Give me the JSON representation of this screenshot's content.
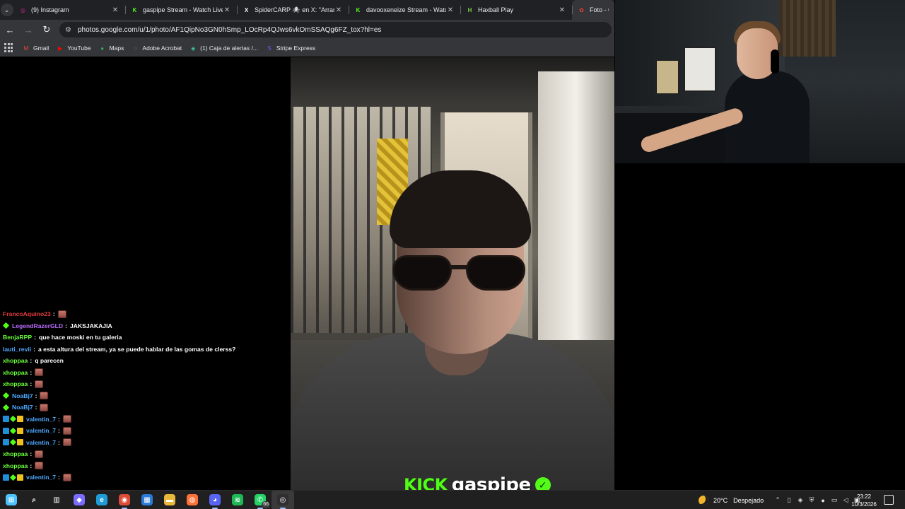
{
  "browser": {
    "tabs": [
      {
        "title": "(9) Instagram",
        "icon": "instagram-icon",
        "color": "#d6249f",
        "glyph": "◎",
        "active": false
      },
      {
        "title": "gaspipe Stream - Watch Live on Kick",
        "icon": "kick-icon",
        "color": "#53fc18",
        "glyph": "K",
        "active": false
      },
      {
        "title": "SpiderCARP 🕷 en X: \"Arranca",
        "icon": "x-icon",
        "color": "#ffffff",
        "glyph": "X",
        "active": false
      },
      {
        "title": "davooxeneize Stream - Watch Live",
        "icon": "kick-icon",
        "color": "#53fc18",
        "glyph": "K",
        "active": false
      },
      {
        "title": "Haxball Play",
        "icon": "haxball-icon",
        "color": "#7cc94a",
        "glyph": "H",
        "active": false
      },
      {
        "title": "Foto - G",
        "icon": "google-photos-icon",
        "color": "#ea4335",
        "glyph": "✿",
        "active": true
      }
    ],
    "url": "photos.google.com/u/1/photo/AF1QipNo3GN0hSmp_LOcRp4QJws6vkOmSSAQg6FZ_tox?hl=es",
    "bookmarks": [
      {
        "label": "Gmail",
        "icon": "gmail-icon",
        "color": "#ea4335",
        "glyph": "M"
      },
      {
        "label": "YouTube",
        "icon": "youtube-icon",
        "color": "#ff0000",
        "glyph": "▶"
      },
      {
        "label": "Maps",
        "icon": "maps-icon",
        "color": "#34a853",
        "glyph": "●"
      },
      {
        "label": "Adobe Acrobat",
        "icon": "acrobat-icon",
        "color": "#bdc1c6",
        "glyph": "◌"
      },
      {
        "label": "(1) Caja de alertas /...",
        "icon": "alerts-icon",
        "color": "#3ad29f",
        "glyph": "◈"
      },
      {
        "label": "Stripe Express",
        "icon": "stripe-icon",
        "color": "#635bff",
        "glyph": "S"
      }
    ]
  },
  "stream": {
    "platform": "KICK",
    "channel": "gaspipe",
    "accent": "#53fc18"
  },
  "chat": [
    {
      "user": "FrancoAquino23",
      "color": "#e53b3b",
      "badges": [],
      "message": "",
      "emote": true
    },
    {
      "user": "LegendRazerGLD",
      "color": "#b86cff",
      "badges": [
        "gem"
      ],
      "message": "JAKSJAKAJIA",
      "emote": false
    },
    {
      "user": "BenjaRPP",
      "color": "#6bff3b",
      "badges": [],
      "message": "que hace moski en tu galeria",
      "emote": false
    },
    {
      "user": "lauti_revii",
      "color": "#4fa8ff",
      "badges": [],
      "message": "a esta altura del stream, ya se puede hablar de las gomas de clerss?",
      "emote": false
    },
    {
      "user": "xhoppaa",
      "color": "#6bff3b",
      "badges": [],
      "message": "q parecen",
      "emote": false
    },
    {
      "user": "xhoppaa",
      "color": "#6bff3b",
      "badges": [],
      "message": "",
      "emote": true
    },
    {
      "user": "xhoppaa",
      "color": "#6bff3b",
      "badges": [],
      "message": "",
      "emote": true
    },
    {
      "user": "NoaBj7",
      "color": "#4fa8ff",
      "badges": [
        "gem"
      ],
      "message": "",
      "emote": true
    },
    {
      "user": "NoaBj7",
      "color": "#4fa8ff",
      "badges": [
        "gem"
      ],
      "message": "",
      "emote": true
    },
    {
      "user": "valentin_7",
      "color": "#4fa8ff",
      "badges": [
        "sub",
        "gem",
        "gift"
      ],
      "message": "",
      "emote": true
    },
    {
      "user": "valentin_7",
      "color": "#4fa8ff",
      "badges": [
        "sub",
        "gem",
        "gift"
      ],
      "message": "",
      "emote": true
    },
    {
      "user": "valentin_7",
      "color": "#4fa8ff",
      "badges": [
        "sub",
        "gem",
        "gift"
      ],
      "message": "",
      "emote": true
    },
    {
      "user": "xhoppaa",
      "color": "#6bff3b",
      "badges": [],
      "message": "",
      "emote": true
    },
    {
      "user": "xhoppaa",
      "color": "#6bff3b",
      "badges": [],
      "message": "",
      "emote": true
    },
    {
      "user": "valentin_7",
      "color": "#4fa8ff",
      "badges": [
        "sub",
        "gem",
        "gift"
      ],
      "message": "",
      "emote": true
    }
  ],
  "taskbar": {
    "apps": [
      {
        "name": "start-icon",
        "color": "#4cc2ff",
        "glyph": "⊞",
        "active": false
      },
      {
        "name": "search-icon",
        "color": "#202020",
        "glyph": "⌕",
        "active": false
      },
      {
        "name": "task-view-icon",
        "color": "#202020",
        "glyph": "▥",
        "active": false
      },
      {
        "name": "copilot-icon",
        "color": "#7a6cff",
        "glyph": "◆",
        "active": false
      },
      {
        "name": "edge-icon",
        "color": "#1f9cd8",
        "glyph": "e",
        "active": false
      },
      {
        "name": "chrome-icon",
        "color": "#dd4b39",
        "glyph": "◉",
        "active": true
      },
      {
        "name": "store-icon",
        "color": "#2a7bd8",
        "glyph": "▦",
        "active": false
      },
      {
        "name": "file-explorer-icon",
        "color": "#e9b83b",
        "glyph": "▬",
        "active": false
      },
      {
        "name": "firefox-icon",
        "color": "#ff7139",
        "glyph": "◍",
        "active": false
      },
      {
        "name": "discord-icon",
        "color": "#5865f2",
        "glyph": "◕",
        "active": true
      },
      {
        "name": "spotify-icon",
        "color": "#1db954",
        "glyph": "≋",
        "active": false
      },
      {
        "name": "whatsapp-icon",
        "color": "#25d366",
        "glyph": "✆",
        "active": true,
        "badge": "66"
      },
      {
        "name": "obs-icon",
        "color": "#302e31",
        "glyph": "◎",
        "active": true,
        "current": true
      }
    ],
    "weather": {
      "temp": "20°C",
      "condition": "Despejado"
    },
    "clock": {
      "time": "23:22",
      "date": "10/3/2026"
    }
  }
}
